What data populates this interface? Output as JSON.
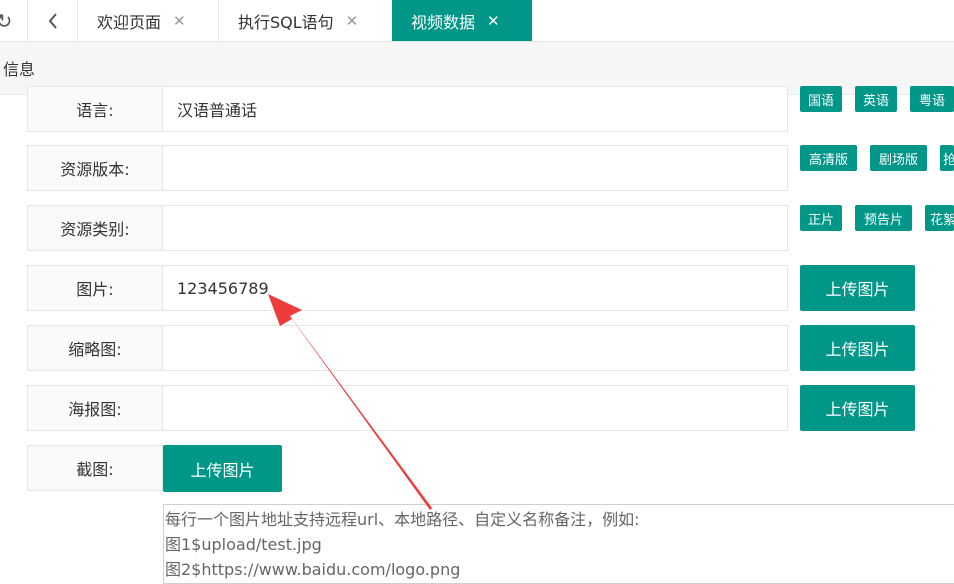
{
  "toolbar": {
    "refresh_icon": "refresh-icon",
    "back_icon": "chevron-left-icon"
  },
  "tabs": [
    {
      "label": "欢迎页面",
      "close": "✕"
    },
    {
      "label": "执行SQL语句",
      "close": "✕"
    },
    {
      "label": "视频数据",
      "close": "✕"
    }
  ],
  "subheader": {
    "title": "信息"
  },
  "form": {
    "language": {
      "label": "语言:",
      "value": "汉语普通话",
      "tags": [
        "国语",
        "英语",
        "粤语"
      ]
    },
    "version": {
      "label": "资源版本:",
      "value": "",
      "tags": [
        "高清版",
        "剧场版",
        "抢"
      ]
    },
    "category": {
      "label": "资源类别:",
      "value": "",
      "tags": [
        "正片",
        "预告片",
        "花絮"
      ]
    },
    "image": {
      "label": "图片:",
      "value": "123456789",
      "button": "上传图片"
    },
    "thumbnail": {
      "label": "缩略图:",
      "value": "",
      "button": "上传图片"
    },
    "poster": {
      "label": "海报图:",
      "value": "",
      "button": "上传图片"
    },
    "screenshot": {
      "label": "截图:",
      "button": "上传图片"
    },
    "screenshot_help": [
      "每行一个图片地址支持远程url、本地路径、自定义名称备注，例如:",
      "图1$upload/test.jpg",
      "图2$https://www.baidu.com/logo.png"
    ]
  },
  "colors": {
    "accent": "#009688",
    "arrow": "#ee3b3b"
  }
}
